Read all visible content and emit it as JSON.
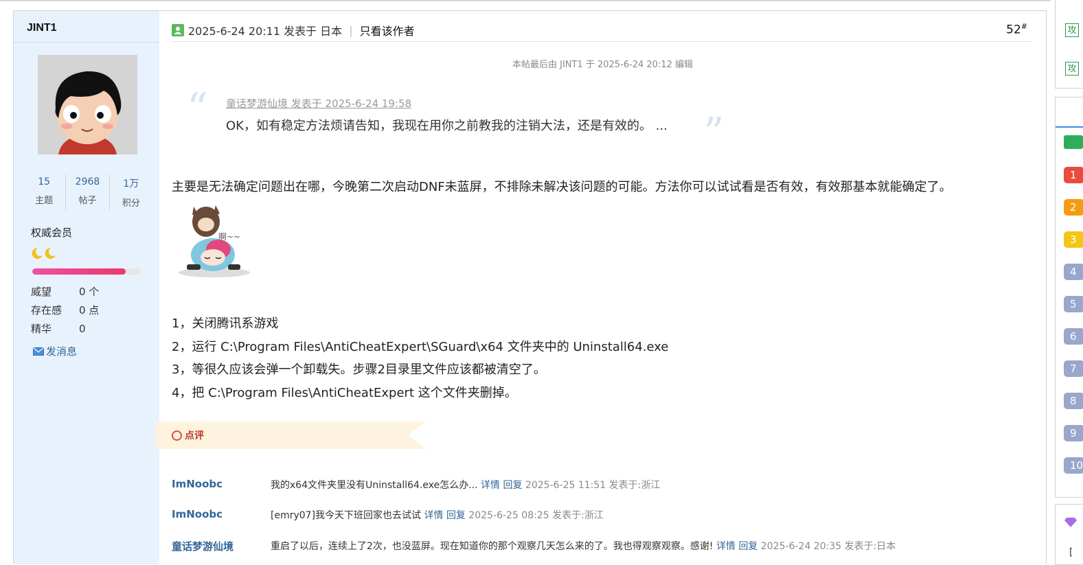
{
  "user": {
    "name": "JINT1",
    "stats": [
      {
        "value": "15",
        "label": "主题"
      },
      {
        "value": "2968",
        "label": "帖子"
      },
      {
        "value": "1万",
        "label": "积分"
      }
    ],
    "group": "权威会员",
    "level_progress": 0.86,
    "info": [
      {
        "key": "威望",
        "value": "0 个"
      },
      {
        "key": "存在感",
        "value": "0 点"
      },
      {
        "key": "精华",
        "value": "0"
      }
    ],
    "send_message": "发消息"
  },
  "post": {
    "posted_at": "2025-6-24 20:11 发表于 日本",
    "only_author": "只看该作者",
    "floor": "52",
    "floor_mark": "#",
    "edited_note": "本帖最后由 JINT1 于 2025-6-24 20:12 编辑",
    "quote": {
      "source": "童话梦游仙境 发表于 2025-6-24 19:58",
      "text": "OK，如有稳定方法烦请告知，我现在用你之前教我的注销大法，还是有效的。 ..."
    },
    "body": "主要是无法确定问题出在哪，今晚第二次启动DNF未蓝屏，不排除未解决该问题的可能。方法你可以试试看是否有效，有效那基本就能确定了。",
    "sticker_text": "啊~~",
    "steps": [
      "1，关闭腾讯系游戏",
      "2，运行 C:\\Program Files\\AntiCheatExpert\\SGuard\\x64 文件夹中的 Uninstall64.exe",
      "3，等很久应该会弹一个卸载失。步骤2目录里文件应该都被清空了。",
      "4，把 C:\\Program Files\\AntiCheatExpert 这个文件夹删掉。"
    ],
    "rating_label": "点评"
  },
  "comments": [
    {
      "user": "ImNoobc",
      "text": "我的x64文件夹里没有Uninstall64.exe怎么办...",
      "detail": "详情",
      "reply": "回复",
      "meta": "2025-6-25 11:51 发表于:浙江"
    },
    {
      "user": "ImNoobc",
      "text": "[emry07]我今天下班回家也去试试",
      "detail": "详情",
      "reply": "回复",
      "meta": "2025-6-25 08:25 发表于:浙江"
    },
    {
      "user": "童话梦游仙境",
      "text": "重启了以后，连续上了2次，也没蓝屏。现在知道你的那个观察几天怎么来的了。我也得观察观察。感谢!",
      "detail": "详情",
      "reply": "回复",
      "meta": "2025-6-24 20:35 发表于:日本"
    }
  ],
  "right_rail": {
    "tags": [
      "攻",
      "攻"
    ],
    "ranks": [
      {
        "num": "1",
        "color": "#e84c3d"
      },
      {
        "num": "2",
        "color": "#f39c12"
      },
      {
        "num": "3",
        "color": "#f5c518"
      },
      {
        "num": "4",
        "color": "#9aa7cc"
      },
      {
        "num": "5",
        "color": "#9aa7cc"
      },
      {
        "num": "6",
        "color": "#9aa7cc"
      },
      {
        "num": "7",
        "color": "#9aa7cc"
      },
      {
        "num": "8",
        "color": "#9aa7cc"
      },
      {
        "num": "9",
        "color": "#9aa7cc"
      },
      {
        "num": "10",
        "color": "#9aa7cc"
      }
    ]
  }
}
